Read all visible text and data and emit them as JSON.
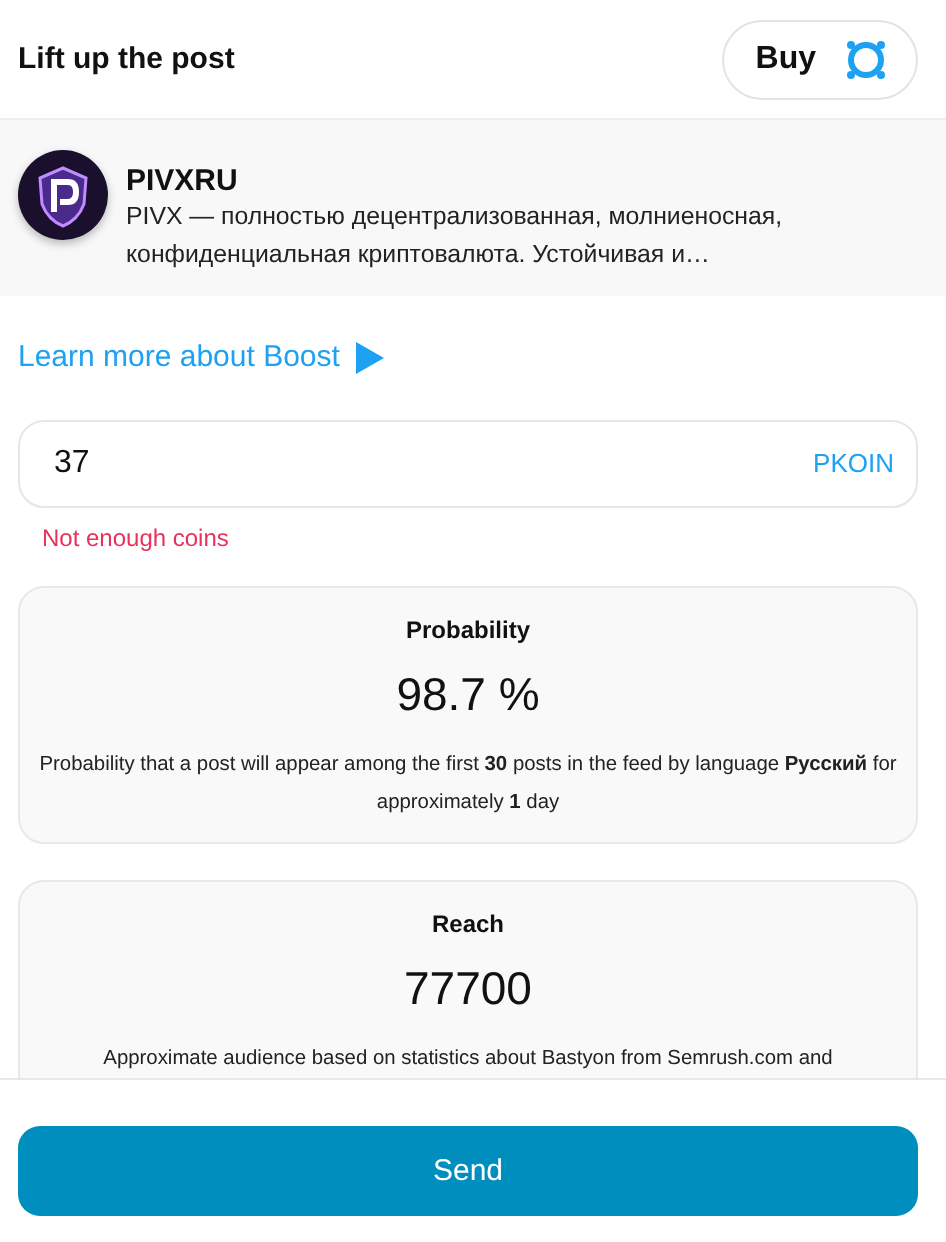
{
  "header": {
    "title": "Lift up the post",
    "buy_button": "Buy"
  },
  "post": {
    "author": "PIVXRU",
    "excerpt": "PIVX — полностью децентрализованная, молниеносная, конфиденциальная криптовалюта. Устойчивая и…"
  },
  "learn_more": {
    "label": "Learn more about Boost"
  },
  "amount": {
    "value": "37",
    "currency": "PKOIN",
    "error": "Not enough coins"
  },
  "stats": [
    {
      "title": "Probability",
      "value": "98.7 %",
      "description": "Probability that a post will appear among the first **30** posts in the feed by language **Русский** for approximately **1** day"
    },
    {
      "title": "Reach",
      "value": "77700",
      "description": "Approximate audience based on statistics about Bastyon from Semrush.com and"
    }
  ],
  "send_button": "Send"
}
